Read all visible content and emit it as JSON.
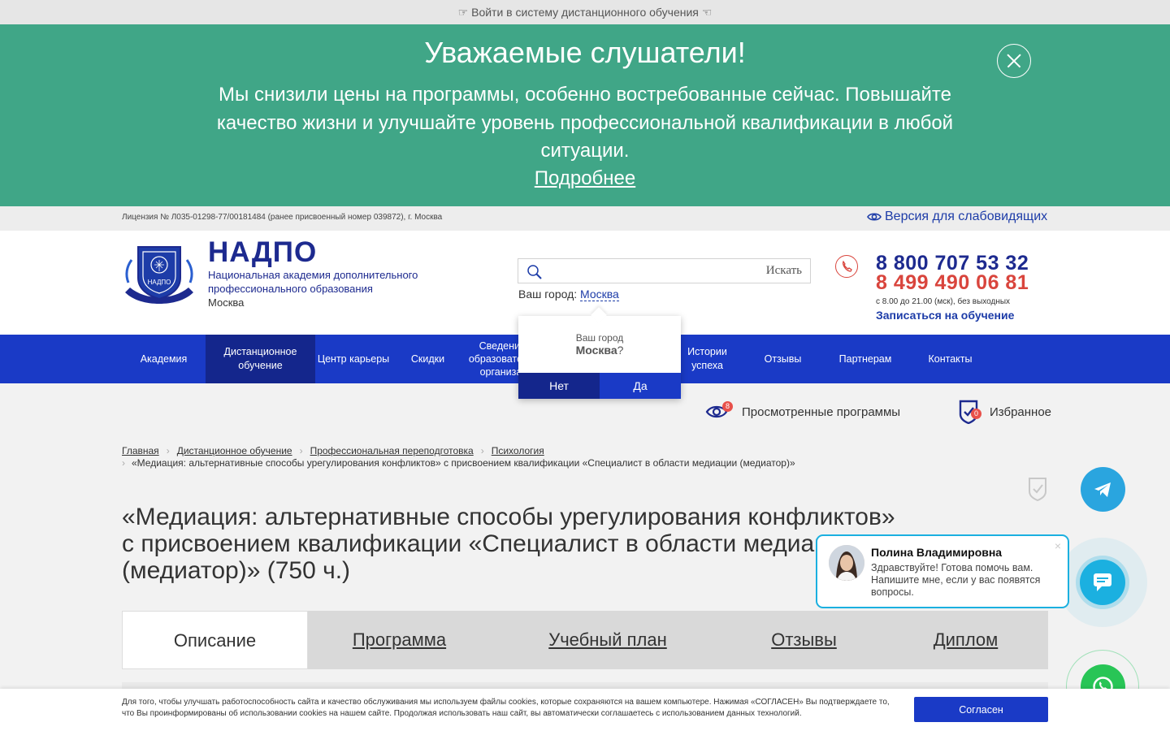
{
  "top_strip": {
    "text": "☞ Войти в систему дистанционного обучения ☜"
  },
  "banner": {
    "title": "Уважаемые слушатели!",
    "text": "Мы снизили цены на программы, особенно востребованные сейчас. Повышайте качество жизни и улучшайте уровень профессиональной квалификации в любой ситуации.",
    "link": "Подробнее",
    "close_icon": "close-circle-icon",
    "color": "#40a687"
  },
  "license_bar": {
    "license": "Лицензия № Л035-01298-77/00181484 (ранее присвоенный номер 039872), г. Москва",
    "low_vision": "Версия для слабовидящих"
  },
  "header": {
    "brand_name": "НАДПО",
    "brand_full_line1": "Национальная академия дополнительного",
    "brand_full_line2": "профессионального образования",
    "brand_city": "Москва",
    "emblem_text": "НАДПО",
    "search": {
      "placeholder": "",
      "button": "Искать"
    },
    "your_city_label": "Ваш город:",
    "your_city_value": "Москва",
    "phone1": "8 800 707 53 32",
    "phone2": "8 499 490 06 81",
    "hours": "с 8.00 до 21.00 (мск), без выходных",
    "enroll": "Записаться на обучение"
  },
  "nav": {
    "color": "#1a3ac6",
    "active_color": "#14268c",
    "items": [
      {
        "label": "Академия"
      },
      {
        "label": "Дистанционное обучение"
      },
      {
        "label": "Центр карьеры"
      },
      {
        "label": "Скидки"
      },
      {
        "label": "Сведения об образовательной организации"
      },
      {
        "label": "Истории успеха"
      },
      {
        "label": "Отзывы"
      },
      {
        "label": "Партнерам"
      },
      {
        "label": "Контакты"
      }
    ]
  },
  "city_popup": {
    "question": "Ваш город",
    "city": "Москва",
    "qmark": "?",
    "no": "Нет",
    "yes": "Да"
  },
  "viewed": {
    "label": "Просмотренные программы",
    "count": "8",
    "icon": "eye-icon"
  },
  "favorites": {
    "label": "Избранное",
    "count": "0",
    "icon": "shield-check-icon"
  },
  "breadcrumb": {
    "items": [
      "Главная",
      "Дистанционное обучение",
      "Профессиональная переподготовка",
      "Психология"
    ],
    "current": "«Медиация: альтернативные способы урегулирования конфликтов» с присвоением квалификации «Специалист в области медиации (медиатор)»"
  },
  "page_title": "«Медиация: альтернативные способы урегулирования конфликтов» с присвоением квалификации «Специалист в области медиации (медиатор)» (750 ч.)",
  "tabs": [
    "Описание",
    "Программа",
    "Учебный план",
    "Отзывы",
    "Диплом"
  ],
  "chat": {
    "name": "Полина Владимировна",
    "text": "Здравствуйте! Готова помочь вам. Напишите мне, если у вас появятся вопросы.",
    "close": "×"
  },
  "cookie": {
    "text": "Для того, чтобы улучшать работоспособность сайта и качество обслуживания мы используем файлы cookies, которые сохраняются на вашем компьютере. Нажимая «СОГЛАСЕН» Вы подтверждаете то, что Вы проинформированы об использовании cookies на нашем сайте. Продолжая использовать наш сайт, вы автоматически соглашаетесь с использованием данных технологий.",
    "button": "Согласен"
  }
}
